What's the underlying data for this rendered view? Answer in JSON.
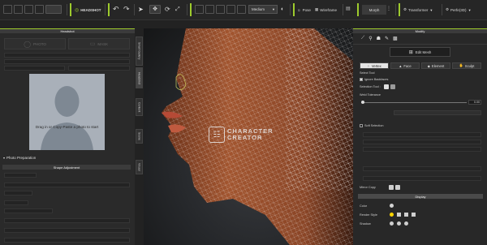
{
  "colors": {
    "accent": "#9ecb2d",
    "skin": "#a2552f",
    "wire": "#f2f2f2"
  },
  "toolbar": {
    "headshot_brand": "HEADSHOT",
    "dd_medium": "Medium",
    "pose": "Pose",
    "wireframe": "Wireframe",
    "morph": "Morph",
    "transformer": "Transformer",
    "perfhd": "Perfe(3D)",
    "icons": [
      "new-file-icon",
      "open-folder-icon",
      "save-icon",
      "import-icon",
      "export-icon",
      "character-icon",
      "undo-icon",
      "redo-icon",
      "select-arrow-icon",
      "move-icon",
      "rotate-icon",
      "scale-icon",
      "camera-icon",
      "frame-icon",
      "light-icon",
      "grid-icon",
      "render-icon"
    ]
  },
  "left": {
    "title": "Headshot",
    "mode_a": "PHOTO",
    "mode_b": "MASK",
    "drop_text": "Drag in or Copy-Paste a photo to start",
    "photo_prep": "Photo Preparation",
    "shape_adjust": "Shape Adjustment"
  },
  "vtabs": [
    "Smart Gallery",
    "Headshot",
    "Content",
    "Scene",
    "Visual"
  ],
  "viewport": {
    "logo_line1": "CHARACTER",
    "logo_line2": "CREATOR"
  },
  "right": {
    "title": "Modify",
    "edit_mesh": "Edit Mesh",
    "tabs": [
      "Vertex",
      "Face",
      "Element",
      "Sculpt"
    ],
    "select_tool": "Select Tool",
    "ignore_backfaces": "Ignore Backfaces",
    "selection_tool": "Selection Tool :",
    "weld_tolerance": "Weld Tolerance",
    "weld_value": "0.00",
    "soft_selection": "Soft Selection",
    "mirror_copy": "Mirror Copy",
    "display": "Display",
    "rows": [
      "Color",
      "Render Style",
      "Shadow"
    ]
  }
}
